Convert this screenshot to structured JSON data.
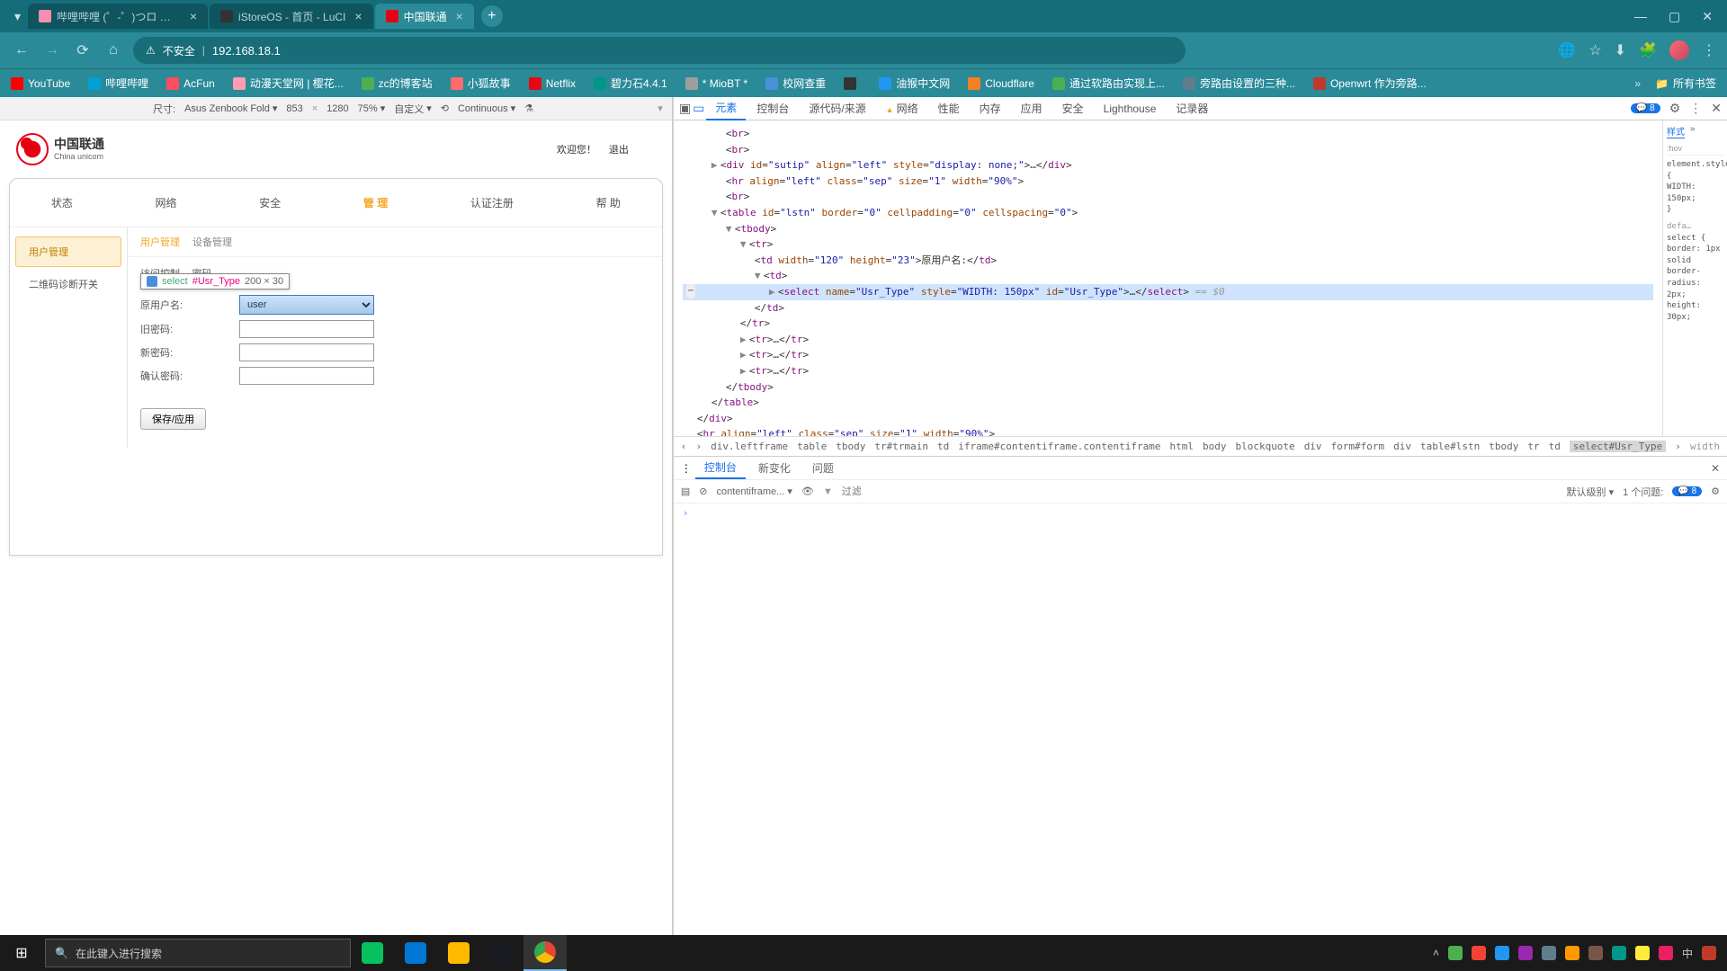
{
  "browser": {
    "tabs": [
      {
        "favicon": "#f48fb1",
        "title": "哔哩哔哩 (゜-゜)つロ 干杯~-b…",
        "active": false
      },
      {
        "favicon": "#333",
        "title": "iStoreOS - 首页 - LuCI",
        "active": false
      },
      {
        "favicon": "#e60012",
        "title": "中国联通",
        "active": true
      }
    ],
    "url_warn": "不安全",
    "url": "192.168.18.1"
  },
  "bookmarks": [
    {
      "color": "#ff0000",
      "label": "YouTube"
    },
    {
      "color": "#00a1d6",
      "label": "哔哩哔哩"
    },
    {
      "color": "#fd4c5d",
      "label": "AcFun"
    },
    {
      "color": "#ff9bb3",
      "label": "动漫天堂网 | 樱花..."
    },
    {
      "color": "#4caf50",
      "label": "zc的博客站"
    },
    {
      "color": "#ff6b6b",
      "label": "小狐故事"
    },
    {
      "color": "#e50914",
      "label": "Netflix"
    },
    {
      "color": "#009688",
      "label": "碧力石4.4.1"
    },
    {
      "color": "#9e9e9e",
      "label": "* MioBT *"
    },
    {
      "color": "#4a90d9",
      "label": "校网查重"
    },
    {
      "color": "#333",
      "label": ""
    },
    {
      "color": "#2196f3",
      "label": "油猴中文网"
    },
    {
      "color": "#f48024",
      "label": "Cloudflare"
    },
    {
      "color": "#4caf50",
      "label": "通过软路由实现上..."
    },
    {
      "color": "#607d8b",
      "label": "旁路由设置的三种..."
    },
    {
      "color": "#c0392b",
      "label": "Openwrt 作为旁路..."
    }
  ],
  "bookmarks_all": "所有书签",
  "device_toolbar": {
    "size_label": "尺寸:",
    "device": "Asus Zenbook Fold",
    "width": "853",
    "height": "1280",
    "zoom": "75%",
    "custom": "自定义",
    "continuous": "Continuous"
  },
  "page": {
    "brand_cn": "中国联通",
    "brand_en": "China unicom",
    "welcome": "欢迎您！",
    "logout": "退出",
    "tabs": [
      "状态",
      "网络",
      "安全",
      "管 理",
      "认证注册",
      "帮 助"
    ],
    "active_tab_index": 3,
    "side_items": [
      "用户管理",
      "二维码诊断开关"
    ],
    "active_side_index": 0,
    "subtabs": [
      "用户管理",
      "设备管理"
    ],
    "active_subtab_index": 0,
    "section": "访问控制 -- 密码",
    "form": {
      "user_label": "原用户名:",
      "user_value": "user",
      "oldpwd_label": "旧密码:",
      "newpwd_label": "新密码:",
      "confirm_label": "确认密码:"
    },
    "inspect_tooltip": {
      "selector": "select",
      "id": "#Usr_Type",
      "dim": "200 × 30"
    },
    "save_btn": "保存/应用"
  },
  "devtools": {
    "tabs": [
      "元素",
      "控制台",
      "源代码/来源",
      "网络",
      "性能",
      "内存",
      "应用",
      "安全",
      "Lighthouse",
      "记录器"
    ],
    "active_tab_index": 0,
    "issue_count": "8",
    "styles_tabs": [
      "样式"
    ],
    "styles_hov": ":hov",
    "style_rule_1": "element.style {",
    "style_rule_2": "  WIDTH: 150px;",
    "style_rule_3": "}",
    "style_rule_4": "select {",
    "style_rule_5": "  border: 1px solid",
    "style_rule_6": "  border-radius: 2px;",
    "style_rule_7": "  height: 30px;",
    "breadcrumb": [
      "div.leftframe",
      "table",
      "tbody",
      "tr#trmain",
      "td",
      "iframe#contentiframe.contentiframe",
      "html",
      "body",
      "blockquote",
      "div",
      "form#form",
      "div",
      "table#lstn",
      "tbody",
      "tr",
      "td",
      "select#Usr_Type"
    ],
    "breadcrumb_right": "width",
    "console": {
      "tabs": [
        "控制台",
        "新变化",
        "问题"
      ],
      "context": "contentiframe...",
      "filter_placeholder": "过滤",
      "level": "默认级别",
      "issues_label": "1 个问题:",
      "issues_count": "8"
    }
  },
  "taskbar": {
    "search": "在此键入进行搜索"
  }
}
